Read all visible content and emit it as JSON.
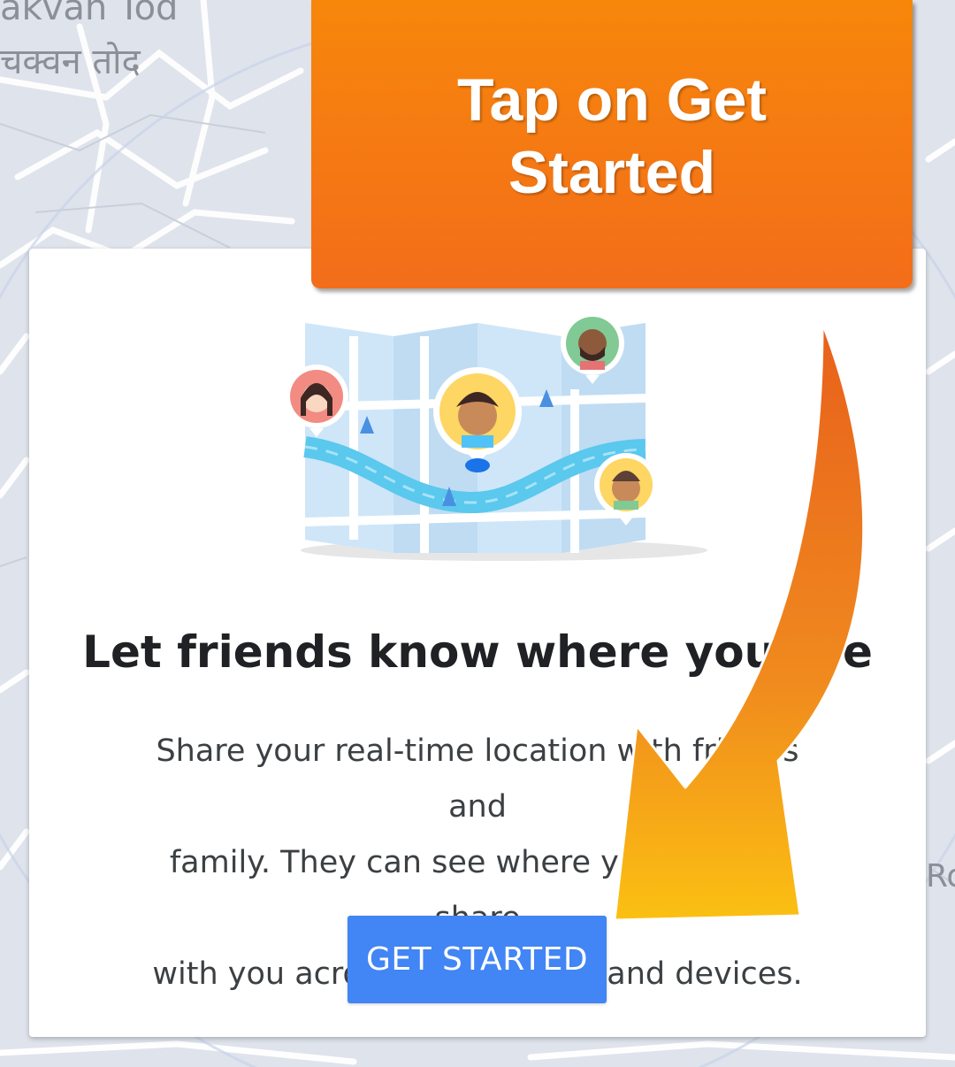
{
  "map": {
    "label_top_en": "akvan Tod",
    "label_top_hi": "चक्वन तोद",
    "label_right_partial": "Ro"
  },
  "card": {
    "title": "Let friends know where you are",
    "body_lines": [
      "Share your real-time location with friends and",
      "family. They can see where you are and share",
      "with you across Google apps and devices."
    ],
    "button_label": "GET STARTED",
    "button_color": "#4285f4"
  },
  "overlay": {
    "banner_line1": "Tap on Get",
    "banner_line2": "Started",
    "banner_color": "#f47c12",
    "arrow_color": "#f26d1c"
  }
}
